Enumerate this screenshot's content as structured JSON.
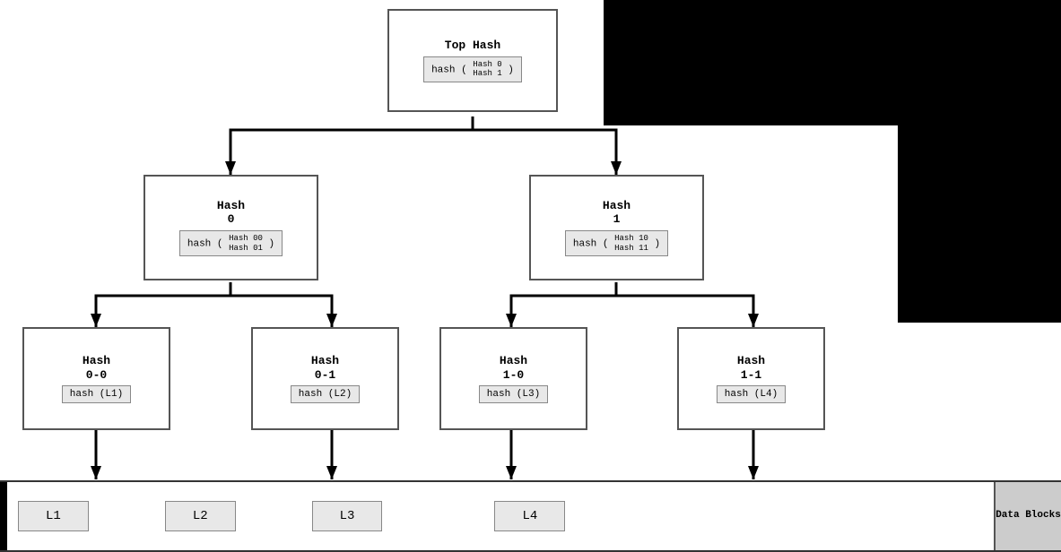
{
  "tree": {
    "top": {
      "title": "Top Hash",
      "formula": "hash ( Hash 0 Hash 1 )"
    },
    "level1": [
      {
        "id": "hash0",
        "title": "Hash\n0",
        "formula": "hash ( Hash 00 Hash 01 )"
      },
      {
        "id": "hash1",
        "title": "Hash\n1",
        "formula": "hash ( Hash 10 Hash 11 )"
      }
    ],
    "level2": [
      {
        "id": "hash00",
        "title": "Hash\n0-0",
        "formula": "hash (L1)"
      },
      {
        "id": "hash01",
        "title": "Hash\n0-1",
        "formula": "hash (L2)"
      },
      {
        "id": "hash10",
        "title": "Hash\n1-0",
        "formula": "hash (L3)"
      },
      {
        "id": "hash11",
        "title": "Hash\n1-1",
        "formula": "hash (L4)"
      }
    ],
    "dataBlocks": {
      "label": "Data\nBlocks",
      "items": [
        "L1",
        "L2",
        "L3",
        "L4"
      ]
    }
  }
}
